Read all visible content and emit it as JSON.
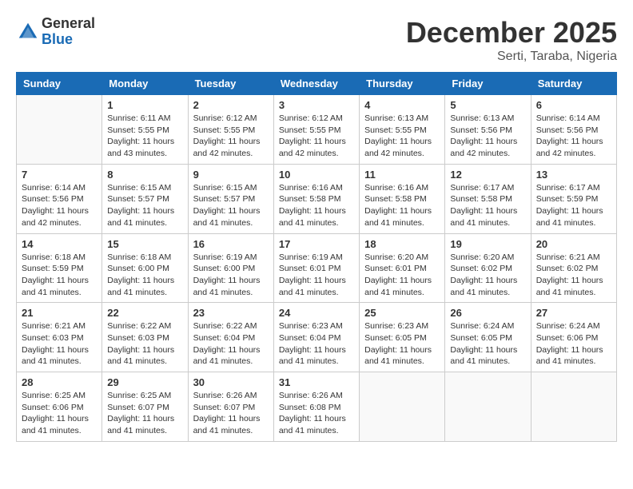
{
  "header": {
    "logo_general": "General",
    "logo_blue": "Blue",
    "title": "December 2025",
    "location": "Serti, Taraba, Nigeria"
  },
  "weekdays": [
    "Sunday",
    "Monday",
    "Tuesday",
    "Wednesday",
    "Thursday",
    "Friday",
    "Saturday"
  ],
  "weeks": [
    [
      {
        "day": "",
        "info": ""
      },
      {
        "day": "1",
        "info": "Sunrise: 6:11 AM\nSunset: 5:55 PM\nDaylight: 11 hours\nand 43 minutes."
      },
      {
        "day": "2",
        "info": "Sunrise: 6:12 AM\nSunset: 5:55 PM\nDaylight: 11 hours\nand 42 minutes."
      },
      {
        "day": "3",
        "info": "Sunrise: 6:12 AM\nSunset: 5:55 PM\nDaylight: 11 hours\nand 42 minutes."
      },
      {
        "day": "4",
        "info": "Sunrise: 6:13 AM\nSunset: 5:55 PM\nDaylight: 11 hours\nand 42 minutes."
      },
      {
        "day": "5",
        "info": "Sunrise: 6:13 AM\nSunset: 5:56 PM\nDaylight: 11 hours\nand 42 minutes."
      },
      {
        "day": "6",
        "info": "Sunrise: 6:14 AM\nSunset: 5:56 PM\nDaylight: 11 hours\nand 42 minutes."
      }
    ],
    [
      {
        "day": "7",
        "info": "Sunrise: 6:14 AM\nSunset: 5:56 PM\nDaylight: 11 hours\nand 42 minutes."
      },
      {
        "day": "8",
        "info": "Sunrise: 6:15 AM\nSunset: 5:57 PM\nDaylight: 11 hours\nand 41 minutes."
      },
      {
        "day": "9",
        "info": "Sunrise: 6:15 AM\nSunset: 5:57 PM\nDaylight: 11 hours\nand 41 minutes."
      },
      {
        "day": "10",
        "info": "Sunrise: 6:16 AM\nSunset: 5:58 PM\nDaylight: 11 hours\nand 41 minutes."
      },
      {
        "day": "11",
        "info": "Sunrise: 6:16 AM\nSunset: 5:58 PM\nDaylight: 11 hours\nand 41 minutes."
      },
      {
        "day": "12",
        "info": "Sunrise: 6:17 AM\nSunset: 5:58 PM\nDaylight: 11 hours\nand 41 minutes."
      },
      {
        "day": "13",
        "info": "Sunrise: 6:17 AM\nSunset: 5:59 PM\nDaylight: 11 hours\nand 41 minutes."
      }
    ],
    [
      {
        "day": "14",
        "info": "Sunrise: 6:18 AM\nSunset: 5:59 PM\nDaylight: 11 hours\nand 41 minutes."
      },
      {
        "day": "15",
        "info": "Sunrise: 6:18 AM\nSunset: 6:00 PM\nDaylight: 11 hours\nand 41 minutes."
      },
      {
        "day": "16",
        "info": "Sunrise: 6:19 AM\nSunset: 6:00 PM\nDaylight: 11 hours\nand 41 minutes."
      },
      {
        "day": "17",
        "info": "Sunrise: 6:19 AM\nSunset: 6:01 PM\nDaylight: 11 hours\nand 41 minutes."
      },
      {
        "day": "18",
        "info": "Sunrise: 6:20 AM\nSunset: 6:01 PM\nDaylight: 11 hours\nand 41 minutes."
      },
      {
        "day": "19",
        "info": "Sunrise: 6:20 AM\nSunset: 6:02 PM\nDaylight: 11 hours\nand 41 minutes."
      },
      {
        "day": "20",
        "info": "Sunrise: 6:21 AM\nSunset: 6:02 PM\nDaylight: 11 hours\nand 41 minutes."
      }
    ],
    [
      {
        "day": "21",
        "info": "Sunrise: 6:21 AM\nSunset: 6:03 PM\nDaylight: 11 hours\nand 41 minutes."
      },
      {
        "day": "22",
        "info": "Sunrise: 6:22 AM\nSunset: 6:03 PM\nDaylight: 11 hours\nand 41 minutes."
      },
      {
        "day": "23",
        "info": "Sunrise: 6:22 AM\nSunset: 6:04 PM\nDaylight: 11 hours\nand 41 minutes."
      },
      {
        "day": "24",
        "info": "Sunrise: 6:23 AM\nSunset: 6:04 PM\nDaylight: 11 hours\nand 41 minutes."
      },
      {
        "day": "25",
        "info": "Sunrise: 6:23 AM\nSunset: 6:05 PM\nDaylight: 11 hours\nand 41 minutes."
      },
      {
        "day": "26",
        "info": "Sunrise: 6:24 AM\nSunset: 6:05 PM\nDaylight: 11 hours\nand 41 minutes."
      },
      {
        "day": "27",
        "info": "Sunrise: 6:24 AM\nSunset: 6:06 PM\nDaylight: 11 hours\nand 41 minutes."
      }
    ],
    [
      {
        "day": "28",
        "info": "Sunrise: 6:25 AM\nSunset: 6:06 PM\nDaylight: 11 hours\nand 41 minutes."
      },
      {
        "day": "29",
        "info": "Sunrise: 6:25 AM\nSunset: 6:07 PM\nDaylight: 11 hours\nand 41 minutes."
      },
      {
        "day": "30",
        "info": "Sunrise: 6:26 AM\nSunset: 6:07 PM\nDaylight: 11 hours\nand 41 minutes."
      },
      {
        "day": "31",
        "info": "Sunrise: 6:26 AM\nSunset: 6:08 PM\nDaylight: 11 hours\nand 41 minutes."
      },
      {
        "day": "",
        "info": ""
      },
      {
        "day": "",
        "info": ""
      },
      {
        "day": "",
        "info": ""
      }
    ]
  ]
}
